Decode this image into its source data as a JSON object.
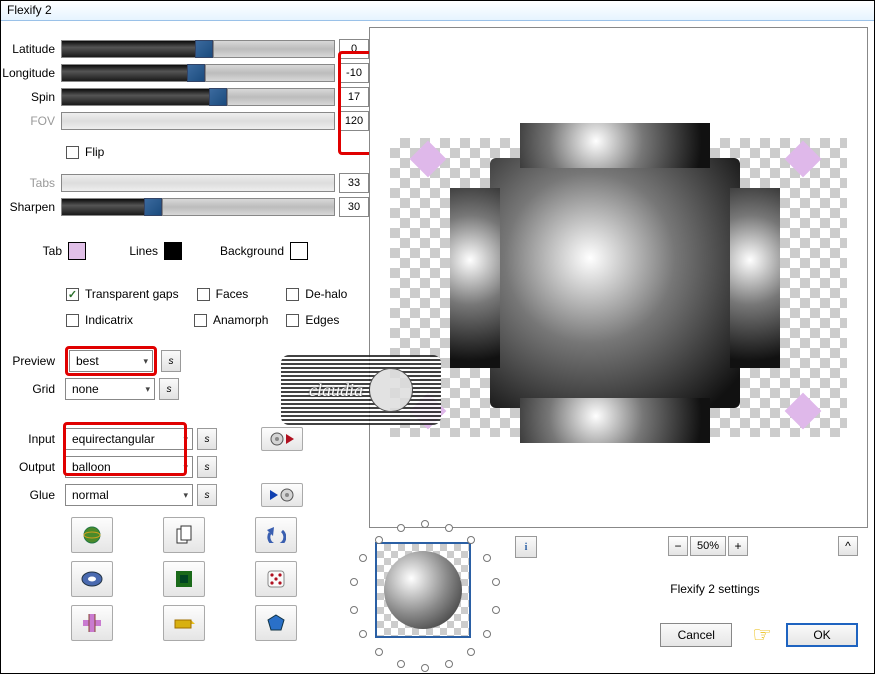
{
  "window": {
    "title": "Flexify 2"
  },
  "sliders": {
    "latitude": {
      "label": "Latitude",
      "value": "0",
      "pos": 49,
      "enabled": true
    },
    "longitude": {
      "label": "Longitude",
      "value": "-10",
      "pos": 46,
      "enabled": true
    },
    "spin": {
      "label": "Spin",
      "value": "17",
      "pos": 54,
      "enabled": true
    },
    "fov": {
      "label": "FOV",
      "value": "120",
      "pos": 0,
      "enabled": false
    },
    "tabs": {
      "label": "Tabs",
      "value": "33",
      "pos": 0,
      "enabled": false
    },
    "sharpen": {
      "label": "Sharpen",
      "value": "30",
      "pos": 30,
      "enabled": true
    }
  },
  "flip": {
    "label": "Flip",
    "checked": false
  },
  "colors": {
    "tab_label": "Tab",
    "tab_color": "#e1c0e8",
    "lines_label": "Lines",
    "lines_color": "#000000",
    "bg_label": "Background",
    "bg_color": "#ffffff"
  },
  "options": {
    "transparent_gaps": {
      "label": "Transparent gaps",
      "checked": true
    },
    "faces": {
      "label": "Faces",
      "checked": false
    },
    "dehalo": {
      "label": "De-halo",
      "checked": false
    },
    "indicatrix": {
      "label": "Indicatrix",
      "checked": false
    },
    "anamorph": {
      "label": "Anamorph",
      "checked": false
    },
    "edges": {
      "label": "Edges",
      "checked": false
    }
  },
  "selects": {
    "preview": {
      "label": "Preview",
      "value": "best"
    },
    "grid": {
      "label": "Grid",
      "value": "none"
    },
    "input": {
      "label": "Input",
      "value": "equirectangular"
    },
    "output": {
      "label": "Output",
      "value": "balloon"
    },
    "glue": {
      "label": "Glue",
      "value": "normal"
    }
  },
  "info_button": "i",
  "zoom": {
    "minus": "−",
    "value": "50%",
    "plus": "+"
  },
  "caret_btn": "^",
  "settings_label": "Flexify 2 settings",
  "buttons": {
    "cancel": "Cancel",
    "ok": "OK"
  },
  "watermark": "claudia"
}
